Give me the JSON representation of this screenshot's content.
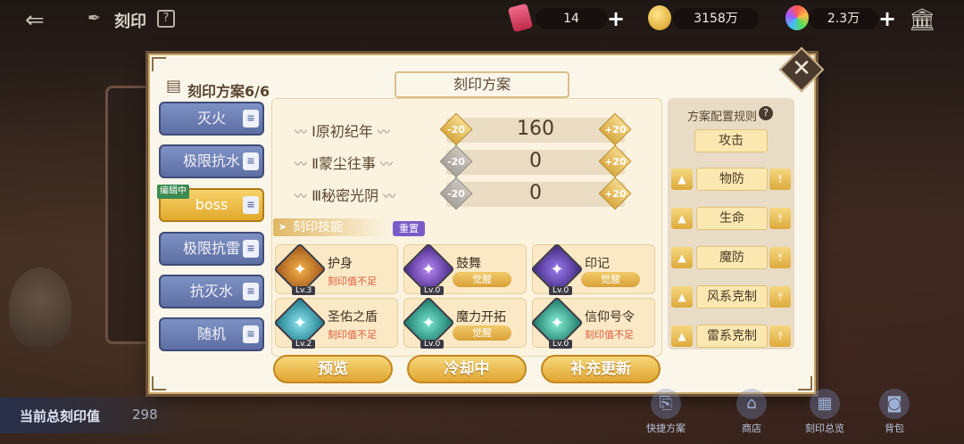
{
  "header": {
    "title": "刻印",
    "resources": [
      {
        "value": "14"
      },
      {
        "value": "3158万"
      },
      {
        "value": "2.3万"
      }
    ]
  },
  "modal": {
    "scheme_count": "刻印方案6/6",
    "title": "刻印方案",
    "schemes": [
      {
        "label": "灭火"
      },
      {
        "label": "极限抗水"
      },
      {
        "label": "boss",
        "tag": "编辑中"
      },
      {
        "label": "极限抗雷"
      },
      {
        "label": "抗灭水"
      },
      {
        "label": "随机"
      }
    ],
    "values": [
      {
        "label": "Ⅰ原初纪年",
        "value": "160",
        "minus": "-20",
        "plus": "+20"
      },
      {
        "label": "Ⅱ蒙尘往事",
        "value": "0",
        "minus": "-20",
        "plus": "+20"
      },
      {
        "label": "Ⅲ秘密光阴",
        "value": "0",
        "minus": "-20",
        "plus": "+20"
      }
    ],
    "skills_title": "刻印技能",
    "reset_label": "重置",
    "skills": [
      {
        "name": "护身",
        "level": "Lv.3",
        "status": "刻印值不足",
        "awaken": ""
      },
      {
        "name": "鼓舞",
        "level": "Lv.0",
        "status": "",
        "awaken": "觉醒"
      },
      {
        "name": "印记",
        "level": "Lv.0",
        "status": "",
        "awaken": "觉醒"
      },
      {
        "name": "圣佑之盾",
        "level": "Lv.2",
        "status": "刻印值不足",
        "awaken": ""
      },
      {
        "name": "魔力开拓",
        "level": "Lv.0",
        "status": "",
        "awaken": "觉醒"
      },
      {
        "name": "信仰号令",
        "level": "Lv.0",
        "status": "刻印值不足",
        "awaken": ""
      }
    ],
    "buttons": {
      "preview": "预览",
      "cooldown": "冷却中",
      "refill": "补充更新"
    },
    "rules": {
      "title": "方案配置规则",
      "attack": "攻击",
      "items": [
        "物防",
        "生命",
        "魔防",
        "风系克制",
        "雷系克制"
      ]
    }
  },
  "footer": {
    "total_label": "当前总刻印值",
    "total_value": "298",
    "nav": [
      "快捷方案",
      "商店",
      "刻印总览",
      "背包"
    ]
  },
  "colors": {
    "gold_button": "#e0a632",
    "blue_scheme": "#5d6ea3",
    "panel_bg": "#fbf6ea",
    "warning_text": "#e05a3a",
    "reset_purple": "#7a5cc9"
  }
}
